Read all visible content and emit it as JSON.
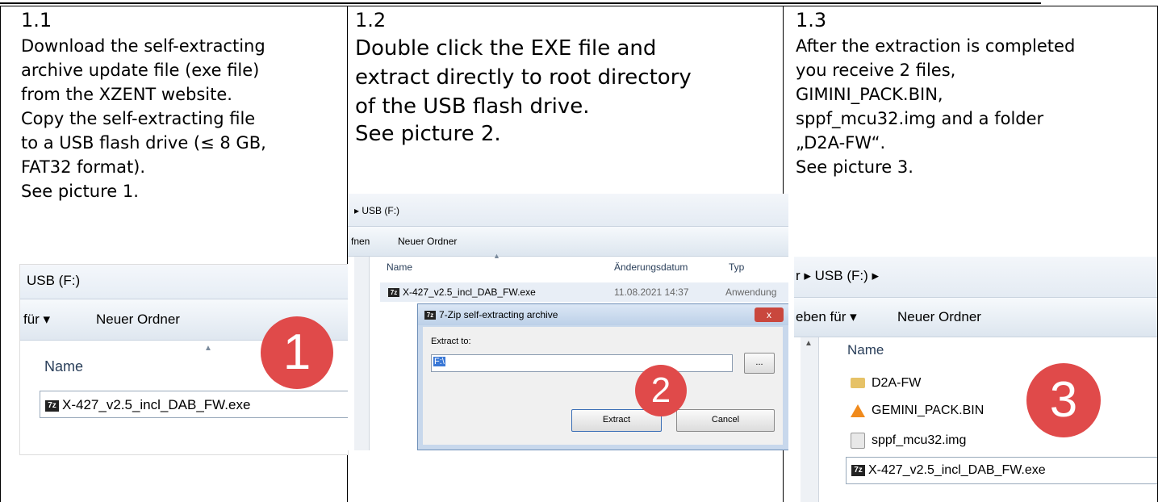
{
  "col1": {
    "step": "1.1",
    "lines": [
      "Download the self-extracting",
      "archive update file (exe file)",
      "from the XZENT website.",
      "Copy the self-extracting file",
      "to a USB flash drive (≤ 8 GB,",
      "FAT32 format).",
      "See picture 1."
    ],
    "shot": {
      "path": "USB (F:)",
      "menu_left": "für ▾",
      "new_folder": "Neuer Ordner",
      "col_name": "Name",
      "file": "X-427_v2.5_incl_DAB_FW.exe",
      "badge": "1"
    }
  },
  "col2": {
    "step": "1.2",
    "lines": [
      "Double click the EXE file and",
      "extract directly to root directory",
      "of the USB flash drive.",
      "See picture 2."
    ],
    "shot": {
      "path": "▸ USB (F:)",
      "menu_left": "fnen",
      "new_folder": "Neuer Ordner",
      "col_name": "Name",
      "col_date": "Änderungsdatum",
      "col_type": "Typ",
      "file": "X-427_v2.5_incl_DAB_FW.exe",
      "file_date": "11.08.2021 14:37",
      "file_type": "Anwendung",
      "dialog_title": "7-Zip self-extracting archive",
      "extract_to": "Extract to:",
      "path_value": "F:\\",
      "browse": "...",
      "extract_btn": "Extract",
      "cancel_btn": "Cancel",
      "close": "x",
      "badge": "2"
    }
  },
  "col3": {
    "step": "1.3",
    "lines": [
      "After the extraction is completed",
      "you receive 2 files,",
      "GIMINI_PACK.BIN,",
      "sppf_mcu32.img and a folder",
      "„D2A-FW“.",
      "See picture 3."
    ],
    "shot": {
      "path": "r ▸ USB (F:) ▸",
      "menu_left": "eben für ▾",
      "new_folder": "Neuer Ordner",
      "col_name": "Name",
      "items": [
        "D2A-FW",
        "GEMINI_PACK.BIN",
        "sppf_mcu32.img",
        "X-427_v2.5_incl_DAB_FW.exe"
      ],
      "badge": "3"
    }
  },
  "icons": {
    "folder": "folder-icon",
    "vlc": "cone-icon",
    "img": "disk-image-icon",
    "exe": "7z-icon"
  },
  "colors": {
    "badge": "#e04a4a",
    "toolbar": "#e8eef5",
    "border": "#b9c6d6"
  }
}
